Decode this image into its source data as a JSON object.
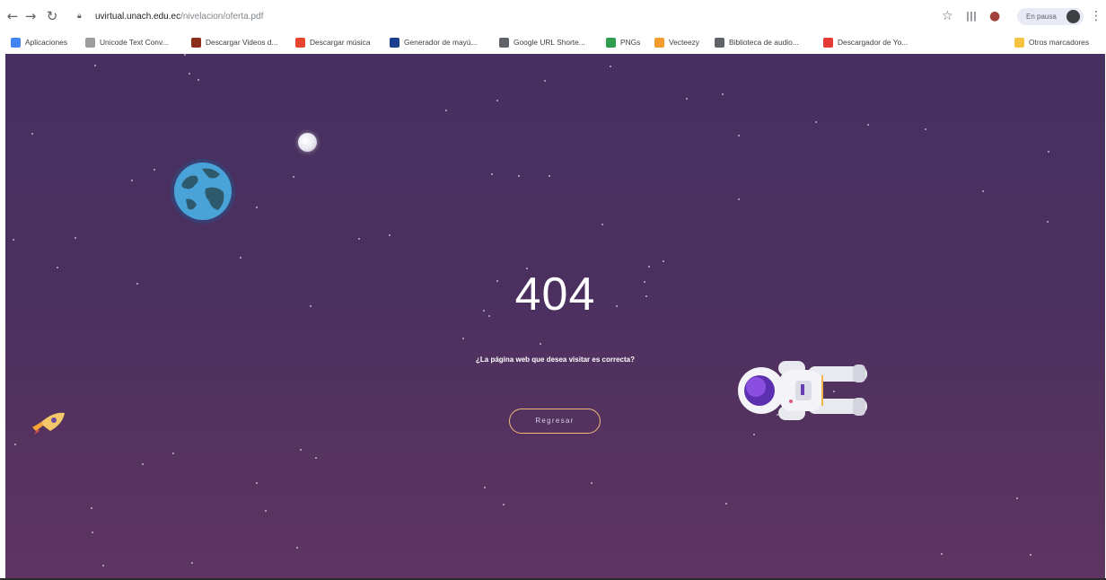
{
  "browser": {
    "url_host": "uvirtual.unach.edu.ec",
    "url_path": "/nivelacion/oferta.pdf",
    "profile_label": "En pausa",
    "bookmarks": [
      {
        "label": "Aplicaciones",
        "color": "#4285f4"
      },
      {
        "label": "Unicode Text Conv...",
        "color": "#9e9e9e"
      },
      {
        "label": "Descargar Videos d...",
        "color": "#8d2e1c"
      },
      {
        "label": "Descargar música",
        "color": "#e8452f"
      },
      {
        "label": "Generador de mayú...",
        "color": "#1a3f8f"
      },
      {
        "label": "Google URL Shorte...",
        "color": "#5f6368"
      },
      {
        "label": "PNGs",
        "color": "#2e9e4d"
      },
      {
        "label": "Vecteezy",
        "color": "#f29a2e"
      },
      {
        "label": "Biblioteca de audio...",
        "color": "#5f6368"
      },
      {
        "label": "Descargador de Yo...",
        "color": "#e53935"
      }
    ],
    "other_bookmarks": "Otros marcadores"
  },
  "page": {
    "error_code": "404",
    "message": "¿La página web que desea visitar es correcta?",
    "back_button": "Regresar"
  },
  "colors": {
    "background_top": "#463060",
    "background_bottom": "#5e3563",
    "button_border": "#f2b87c"
  }
}
